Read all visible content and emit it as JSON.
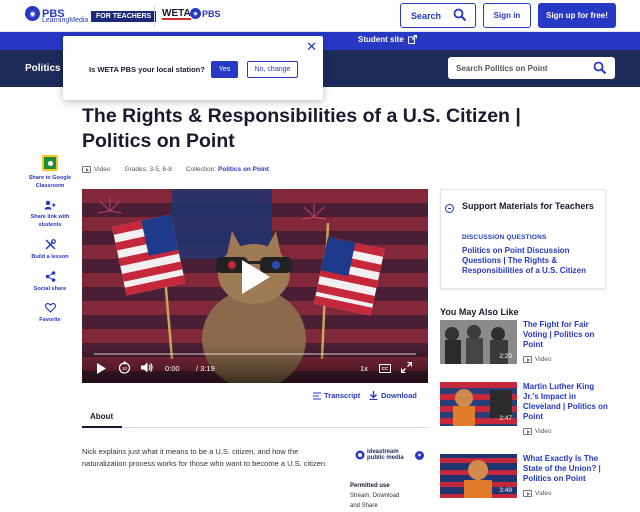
{
  "header": {
    "logo_brand": "PBS",
    "logo_sub": "LearningMedia",
    "for_teachers": "FOR TEACHERS",
    "station_logo": "WETA",
    "station_pbs": "PBS",
    "search_label": "Search",
    "signin_label": "Sign in",
    "signup_label": "Sign up for free!"
  },
  "nav": {
    "student_site": "Student site"
  },
  "collection_bar": {
    "title": "Politics on Point",
    "search_placeholder": "Search Politics on Point"
  },
  "popup": {
    "question": "Is WETA PBS your local station?",
    "yes_label": "Yes",
    "no_label": "No, change"
  },
  "page": {
    "title": "The Rights & Responsibilities of a U.S. Citizen | Politics on Point",
    "type": "Video",
    "grades": "Grades: 3-5, 6-8",
    "collection_prefix": "Collection:",
    "collection": "Politics on Point"
  },
  "actions": [
    {
      "label": "Share to Google Classroom",
      "icon": "google-classroom-icon"
    },
    {
      "label": "Share link with students",
      "icon": "share-link-icon"
    },
    {
      "label": "Build a lesson",
      "icon": "build-lesson-icon"
    },
    {
      "label": "Social share",
      "icon": "social-share-icon"
    },
    {
      "label": "Favorite",
      "icon": "heart-icon"
    }
  ],
  "video": {
    "current_time": "0:00",
    "duration": "/ 3:19",
    "speed": "1x",
    "cc": "CC",
    "progress": 0
  },
  "links": {
    "transcript": "Transcript",
    "download": "Download"
  },
  "about": {
    "tab_label": "About",
    "description": "Nick explains just what it means to be a U.S. citizen, and how the naturalization process works for those who want to become a U.S. citizen.",
    "partner_logo": "ideastream public media",
    "permitted_label": "Permitted use",
    "permitted_value": "Stream, Download and Share"
  },
  "support": {
    "heading": "Support Materials for Teachers",
    "section": "DISCUSSION QUESTIONS",
    "link": "Politics on Point Discussion Questions | The Rights & Responsibilities of a U.S. Citizen"
  },
  "related": {
    "heading": "You May Also Like",
    "items": [
      {
        "title": "The Fight for Fair Voting | Politics on Point",
        "duration": "2:20",
        "type": "Video"
      },
      {
        "title": "Martin Luther King Jr.'s Impact in Cleveland | Politics on Point",
        "duration": "2:47",
        "type": "Video"
      },
      {
        "title": "What Exactly Is The State of the Union? | Politics on Point",
        "duration": "3:49",
        "type": "Video"
      }
    ]
  },
  "colors": {
    "brand_blue": "#2638c4",
    "navy": "#1d2a5a",
    "popup_yes": "#2638c4"
  }
}
